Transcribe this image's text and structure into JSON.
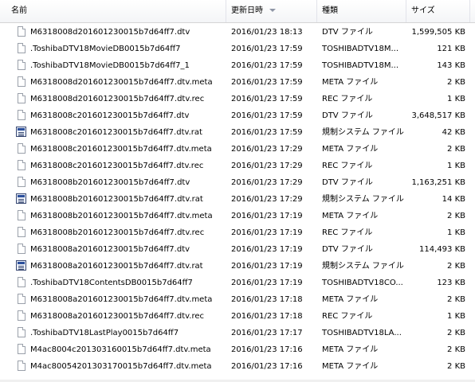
{
  "columns": {
    "name": "名前",
    "date": "更新日時",
    "type": "種類",
    "size": "サイズ"
  },
  "files": [
    {
      "name": "M6318008d201601230015b7d64ff7.dtv",
      "date": "2016/01/23 18:13",
      "type": "DTV ファイル",
      "size": "1,599,505 KB",
      "icon": "file-icon"
    },
    {
      "name": ".ToshibaDTV18MovieDB0015b7d64ff7",
      "date": "2016/01/23 17:59",
      "type": "TOSHIBADTV18M...",
      "size": "121 KB",
      "icon": "file-icon"
    },
    {
      "name": ".ToshibaDTV18MovieDB0015b7d64ff7_1",
      "date": "2016/01/23 17:59",
      "type": "TOSHIBADTV18M...",
      "size": "143 KB",
      "icon": "file-icon"
    },
    {
      "name": "M6318008d201601230015b7d64ff7.dtv.meta",
      "date": "2016/01/23 17:59",
      "type": "META ファイル",
      "size": "2 KB",
      "icon": "file-icon"
    },
    {
      "name": "M6318008d201601230015b7d64ff7.dtv.rec",
      "date": "2016/01/23 17:59",
      "type": "REC ファイル",
      "size": "1 KB",
      "icon": "file-icon"
    },
    {
      "name": "M6318008c201601230015b7d64ff7.dtv",
      "date": "2016/01/23 17:59",
      "type": "DTV ファイル",
      "size": "3,648,517 KB",
      "icon": "file-icon"
    },
    {
      "name": "M6318008c201601230015b7d64ff7.dtv.rat",
      "date": "2016/01/23 17:59",
      "type": "規制システム ファイル",
      "size": "42 KB",
      "icon": "rat-icon"
    },
    {
      "name": "M6318008c201601230015b7d64ff7.dtv.meta",
      "date": "2016/01/23 17:29",
      "type": "META ファイル",
      "size": "2 KB",
      "icon": "file-icon"
    },
    {
      "name": "M6318008c201601230015b7d64ff7.dtv.rec",
      "date": "2016/01/23 17:29",
      "type": "REC ファイル",
      "size": "1 KB",
      "icon": "file-icon"
    },
    {
      "name": "M6318008b201601230015b7d64ff7.dtv",
      "date": "2016/01/23 17:29",
      "type": "DTV ファイル",
      "size": "1,163,251 KB",
      "icon": "file-icon"
    },
    {
      "name": "M6318008b201601230015b7d64ff7.dtv.rat",
      "date": "2016/01/23 17:29",
      "type": "規制システム ファイル",
      "size": "14 KB",
      "icon": "rat-icon"
    },
    {
      "name": "M6318008b201601230015b7d64ff7.dtv.meta",
      "date": "2016/01/23 17:19",
      "type": "META ファイル",
      "size": "2 KB",
      "icon": "file-icon"
    },
    {
      "name": "M6318008b201601230015b7d64ff7.dtv.rec",
      "date": "2016/01/23 17:19",
      "type": "REC ファイル",
      "size": "1 KB",
      "icon": "file-icon"
    },
    {
      "name": "M6318008a201601230015b7d64ff7.dtv",
      "date": "2016/01/23 17:19",
      "type": "DTV ファイル",
      "size": "114,493 KB",
      "icon": "file-icon"
    },
    {
      "name": "M6318008a201601230015b7d64ff7.dtv.rat",
      "date": "2016/01/23 17:19",
      "type": "規制システム ファイル",
      "size": "2 KB",
      "icon": "rat-icon"
    },
    {
      "name": ".ToshibaDTV18ContentsDB0015b7d64ff7",
      "date": "2016/01/23 17:19",
      "type": "TOSHIBADTV18CO...",
      "size": "123 KB",
      "icon": "file-icon"
    },
    {
      "name": "M6318008a201601230015b7d64ff7.dtv.meta",
      "date": "2016/01/23 17:18",
      "type": "META ファイル",
      "size": "2 KB",
      "icon": "file-icon"
    },
    {
      "name": "M6318008a201601230015b7d64ff7.dtv.rec",
      "date": "2016/01/23 17:18",
      "type": "REC ファイル",
      "size": "1 KB",
      "icon": "file-icon"
    },
    {
      "name": ".ToshibaDTV18LastPlay0015b7d64ff7",
      "date": "2016/01/23 17:17",
      "type": "TOSHIBADTV18LA...",
      "size": "2 KB",
      "icon": "file-icon"
    },
    {
      "name": "M4ac8004c201303160015b7d64ff7.dtv.meta",
      "date": "2016/01/23 17:16",
      "type": "META ファイル",
      "size": "2 KB",
      "icon": "file-icon"
    },
    {
      "name": "M4ac80054201303170015b7d64ff7.dtv.meta",
      "date": "2016/01/23 17:16",
      "type": "META ファイル",
      "size": "2 KB",
      "icon": "file-icon"
    }
  ]
}
